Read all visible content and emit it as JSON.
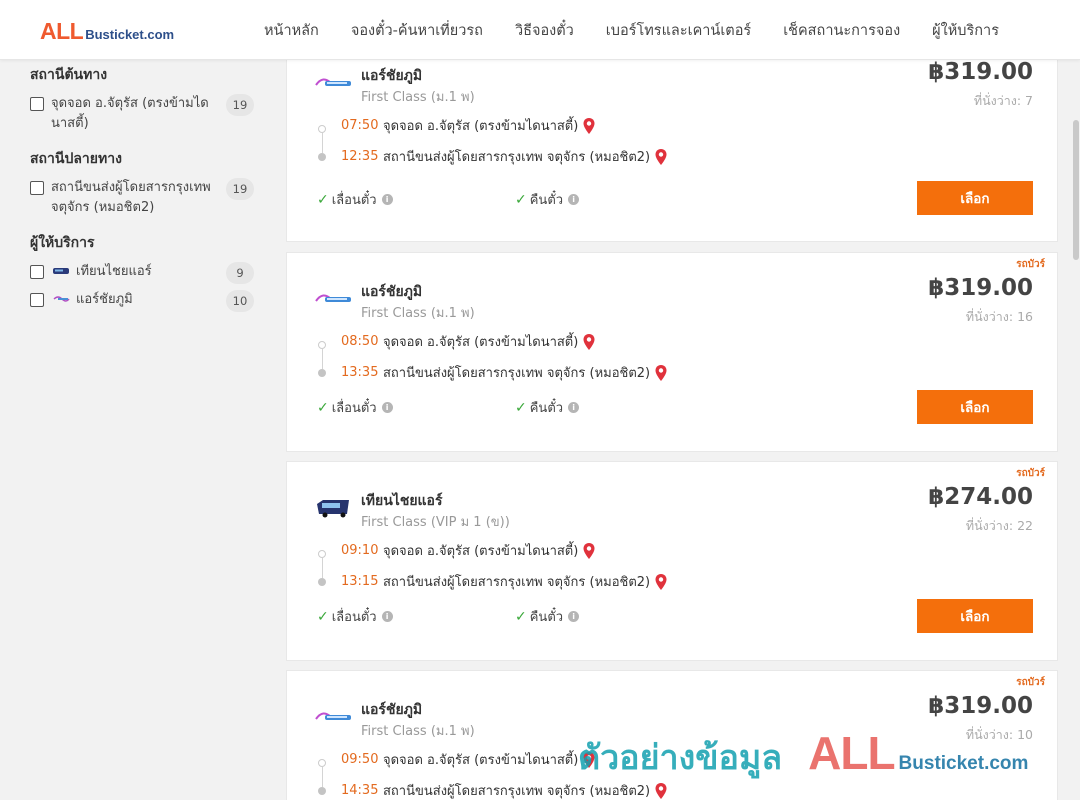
{
  "header": {
    "logo_all": "ALL",
    "logo_rest": "Busticket.com",
    "nav": [
      "หน้าหลัก",
      "จองตั๋ว-ค้นหาเที่ยวรถ",
      "วิธีจองตั๋ว",
      "เบอร์โทรและเคาน์เตอร์",
      "เช็คสถานะการจอง",
      "ผู้ให้บริการ"
    ]
  },
  "filters": {
    "origin": {
      "title": "สถานีต้นทาง",
      "items": [
        {
          "label": "จุดจอด อ.จัตุรัส (ตรงข้ามไดนาสตี้)",
          "count": "19"
        }
      ]
    },
    "destination": {
      "title": "สถานีปลายทาง",
      "items": [
        {
          "label": "สถานีขนส่งผู้โดยสารกรุงเทพ จตุจักร (หมอชิต2)",
          "count": "19"
        }
      ]
    },
    "operator": {
      "title": "ผู้ให้บริการ",
      "items": [
        {
          "label": "เทียนไชยแอร์",
          "count": "9",
          "logo": "tianchai-air-logo"
        },
        {
          "label": "แอร์ชัยภูมิ",
          "count": "10",
          "logo": "air-chaiyaphum-logo"
        }
      ]
    }
  },
  "trips": [
    {
      "ribbon": "",
      "operator": "แอร์ชัยภูมิ",
      "bus_type": "First Class (ม.1 พ)",
      "price": "฿319.00",
      "seats": "ที่นั่งว่าง: 7",
      "depart_time": "07:50",
      "depart_place": "จุดจอด อ.จัตุรัส (ตรงข้ามไดนาสตี้)",
      "arrive_time": "12:35",
      "arrive_place": "สถานีขนส่งผู้โดยสารกรุงเทพ จตุจักร (หมอชิต2)",
      "policy1": "เลื่อนตั๋ว",
      "policy2": "คืนตั๋ว",
      "button": "เลือก",
      "logo": "air-chaiyaphum-logo"
    },
    {
      "ribbon": "รถบัวร์",
      "operator": "แอร์ชัยภูมิ",
      "bus_type": "First Class (ม.1 พ)",
      "price": "฿319.00",
      "seats": "ที่นั่งว่าง: 16",
      "depart_time": "08:50",
      "depart_place": "จุดจอด อ.จัตุรัส (ตรงข้ามไดนาสตี้)",
      "arrive_time": "13:35",
      "arrive_place": "สถานีขนส่งผู้โดยสารกรุงเทพ จตุจักร (หมอชิต2)",
      "policy1": "เลื่อนตั๋ว",
      "policy2": "คืนตั๋ว",
      "button": "เลือก",
      "logo": "air-chaiyaphum-logo"
    },
    {
      "ribbon": "รถบัวร์",
      "operator": "เทียนไชยแอร์",
      "bus_type": "First Class (VIP ม 1 (ข))",
      "price": "฿274.00",
      "seats": "ที่นั่งว่าง: 22",
      "depart_time": "09:10",
      "depart_place": "จุดจอด อ.จัตุรัส (ตรงข้ามไดนาสตี้)",
      "arrive_time": "13:15",
      "arrive_place": "สถานีขนส่งผู้โดยสารกรุงเทพ จตุจักร (หมอชิต2)",
      "policy1": "เลื่อนตั๋ว",
      "policy2": "คืนตั๋ว",
      "button": "เลือก",
      "logo": "tianchai-air-logo"
    },
    {
      "ribbon": "รถบัวร์",
      "operator": "แอร์ชัยภูมิ",
      "bus_type": "First Class (ม.1 พ)",
      "price": "฿319.00",
      "seats": "ที่นั่งว่าง: 10",
      "depart_time": "09:50",
      "depart_place": "จุดจอด อ.จัตุรัส (ตรงข้ามไดนาสตี้)",
      "arrive_time": "14:35",
      "arrive_place": "สถานีขนส่งผู้โดยสารกรุงเทพ จตุจักร (หมอชิต2)",
      "policy1": "เลื่อนตั๋ว",
      "policy2": "คืนตั๋ว",
      "button": "เลือก",
      "logo": "air-chaiyaphum-logo"
    }
  ],
  "watermark": {
    "thai": "ตัวอย่างข้อมูล",
    "all": "ALL",
    "rest": "Busticket.com"
  },
  "colors": {
    "accent": "#f46f0c",
    "time": "#e36a1f",
    "check": "#3aa83a",
    "pin": "#e0323c"
  }
}
